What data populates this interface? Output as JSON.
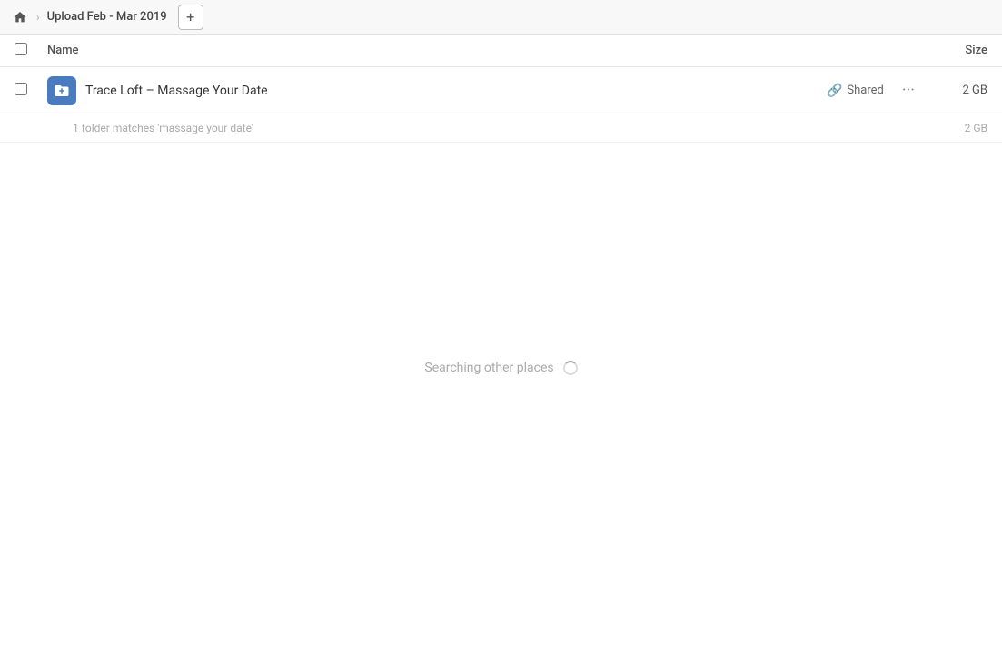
{
  "topbar": {
    "breadcrumb": "Upload Feb - Mar 2019",
    "add_btn_label": "+",
    "home_icon": "home-icon"
  },
  "columns": {
    "name_label": "Name",
    "size_label": "Size"
  },
  "file_row": {
    "name": "Trace Loft – Massage Your Date",
    "shared_label": "Shared",
    "size": "2 GB",
    "icon": "folder-shared-icon"
  },
  "match_info": {
    "text": "1 folder matches 'massage your date'",
    "size": "2 GB"
  },
  "searching": {
    "text": "Searching other places"
  }
}
